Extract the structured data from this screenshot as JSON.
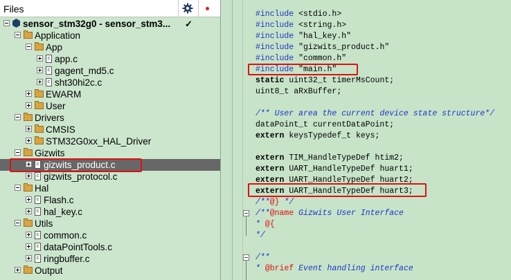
{
  "files_panel": {
    "title": "Files",
    "gear_icon": "gear-icon",
    "dot_icon": "red-dot-icon",
    "check": "✓"
  },
  "tree": [
    {
      "label": "sensor_stm32g0 - sensor_stm3...",
      "type": "root",
      "level": 0
    },
    {
      "label": "Application",
      "type": "folder",
      "level": 1,
      "exp": "minus"
    },
    {
      "label": "App",
      "type": "folder",
      "level": 2,
      "exp": "minus"
    },
    {
      "label": "app.c",
      "type": "file",
      "level": 3,
      "exp": "plus"
    },
    {
      "label": "gagent_md5.c",
      "type": "file",
      "level": 3,
      "exp": "plus"
    },
    {
      "label": "sht30hi2c.c",
      "type": "file",
      "level": 3,
      "exp": "plus"
    },
    {
      "label": "EWARM",
      "type": "folder",
      "level": 2,
      "exp": "plus"
    },
    {
      "label": "User",
      "type": "folder",
      "level": 2,
      "exp": "plus"
    },
    {
      "label": "Drivers",
      "type": "folder",
      "level": 1,
      "exp": "minus"
    },
    {
      "label": "CMSIS",
      "type": "folder",
      "level": 2,
      "exp": "plus"
    },
    {
      "label": "STM32G0xx_HAL_Driver",
      "type": "folder",
      "level": 2,
      "exp": "plus"
    },
    {
      "label": "Gizwits",
      "type": "folder",
      "level": 1,
      "exp": "minus"
    },
    {
      "label": "gizwits_product.c",
      "type": "file",
      "level": 2,
      "exp": "plus",
      "selected": true
    },
    {
      "label": "gizwits_protocol.c",
      "type": "file",
      "level": 2,
      "exp": "plus"
    },
    {
      "label": "Hal",
      "type": "folder",
      "level": 1,
      "exp": "minus"
    },
    {
      "label": "Flash.c",
      "type": "file",
      "level": 2,
      "exp": "plus"
    },
    {
      "label": "hal_key.c",
      "type": "file",
      "level": 2,
      "exp": "plus"
    },
    {
      "label": "Utils",
      "type": "folder",
      "level": 1,
      "exp": "minus"
    },
    {
      "label": "common.c",
      "type": "file",
      "level": 2,
      "exp": "plus"
    },
    {
      "label": "dataPointTools.c",
      "type": "file",
      "level": 2,
      "exp": "plus"
    },
    {
      "label": "ringbuffer.c",
      "type": "file",
      "level": 2,
      "exp": "plus"
    },
    {
      "label": "Output",
      "type": "folder",
      "level": 1,
      "exp": "plus"
    }
  ],
  "code": [
    {
      "parts": [
        [
          "kw-blue",
          "#include"
        ],
        [
          "",
          " <stdio.h>"
        ]
      ]
    },
    {
      "parts": [
        [
          "kw-blue",
          "#include"
        ],
        [
          "",
          " <string.h>"
        ]
      ]
    },
    {
      "parts": [
        [
          "kw-blue",
          "#include"
        ],
        [
          "",
          " \"hal_key.h\""
        ]
      ]
    },
    {
      "parts": [
        [
          "kw-blue",
          "#include"
        ],
        [
          "",
          " \"gizwits_product.h\""
        ]
      ]
    },
    {
      "parts": [
        [
          "kw-blue",
          "#include"
        ],
        [
          "",
          " \"common.h\""
        ]
      ]
    },
    {
      "parts": [
        [
          "kw-blue",
          "#include"
        ],
        [
          "",
          " \"main.h\""
        ]
      ]
    },
    {
      "parts": [
        [
          "kw-bold",
          "static"
        ],
        [
          "",
          " uint32_t timerMsCount;"
        ]
      ]
    },
    {
      "parts": [
        [
          "",
          "uint8_t aRxBuffer;"
        ]
      ]
    },
    {
      "parts": []
    },
    {
      "parts": [
        [
          "cm",
          "/** User area the current device state structure*/"
        ]
      ]
    },
    {
      "parts": [
        [
          "",
          "dataPoint_t currentDataPoint;"
        ]
      ]
    },
    {
      "parts": [
        [
          "kw-bold",
          "extern"
        ],
        [
          "",
          " keysTypedef_t keys;"
        ]
      ]
    },
    {
      "parts": []
    },
    {
      "parts": [
        [
          "kw-bold",
          "extern"
        ],
        [
          "",
          " TIM_HandleTypeDef htim2;"
        ]
      ]
    },
    {
      "parts": [
        [
          "kw-bold",
          "extern"
        ],
        [
          "",
          " UART_HandleTypeDef huart1;"
        ]
      ]
    },
    {
      "parts": [
        [
          "kw-bold",
          "extern"
        ],
        [
          "",
          " UART_HandleTypeDef huart2;"
        ]
      ]
    },
    {
      "parts": [
        [
          "kw-bold",
          "extern"
        ],
        [
          "",
          " UART_HandleTypeDef huart3;"
        ]
      ]
    },
    {
      "parts": [
        [
          "cm",
          "/**"
        ],
        [
          "red",
          "@}"
        ],
        [
          "cm",
          " */"
        ]
      ]
    },
    {
      "parts": [
        [
          "cm",
          "/**"
        ],
        [
          "red",
          "@name"
        ],
        [
          "cm",
          " Gizwits User Interface"
        ]
      ]
    },
    {
      "parts": [
        [
          "cm",
          "* "
        ],
        [
          "red",
          "@{"
        ]
      ]
    },
    {
      "parts": [
        [
          "cm",
          "*/"
        ]
      ]
    },
    {
      "parts": []
    },
    {
      "parts": [
        [
          "cm",
          "/**"
        ]
      ]
    },
    {
      "parts": [
        [
          "cm",
          "* "
        ],
        [
          "red",
          "@brief"
        ],
        [
          "cm",
          " Event handling interface"
        ]
      ]
    }
  ]
}
